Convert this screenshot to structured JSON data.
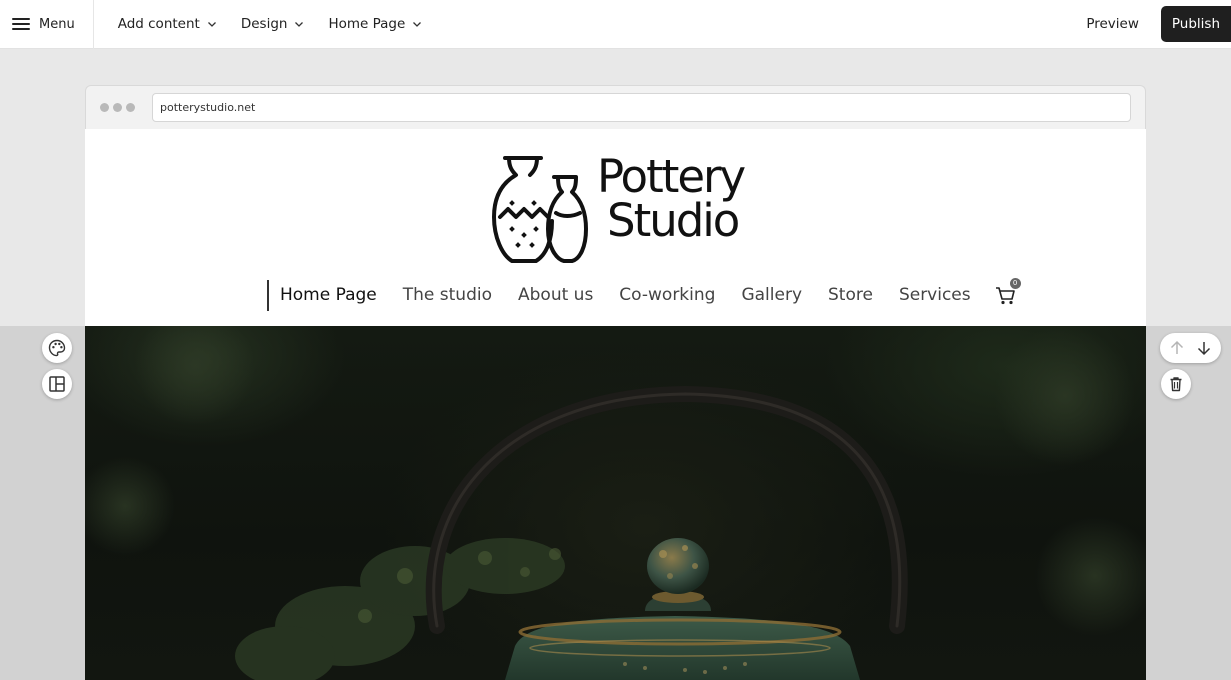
{
  "topbar": {
    "menu_label": "Menu",
    "add_content_label": "Add content",
    "design_label": "Design",
    "page_label": "Home Page",
    "preview_label": "Preview",
    "publish_label": "Publish"
  },
  "browser": {
    "url": "potterystudio.net"
  },
  "site": {
    "logo_line1": "Pottery",
    "logo_line2": "Studio",
    "nav": [
      {
        "label": "Home Page"
      },
      {
        "label": "The studio"
      },
      {
        "label": "About us"
      },
      {
        "label": "Co-working"
      },
      {
        "label": "Gallery"
      },
      {
        "label": "Store"
      },
      {
        "label": "Services"
      }
    ],
    "cart_count": "0"
  },
  "tools": {
    "left": [
      "palette-icon",
      "layout-icon"
    ],
    "right": [
      "arrow-up-icon",
      "arrow-down-icon",
      "trash-icon"
    ]
  },
  "colors": {
    "publish_bg": "#1f1f1f",
    "canvas_bg": "#e8e8e8",
    "hero_dark": "#0f130e",
    "teapot_green": "#2f4a3a",
    "brass": "#9a7a3c"
  }
}
